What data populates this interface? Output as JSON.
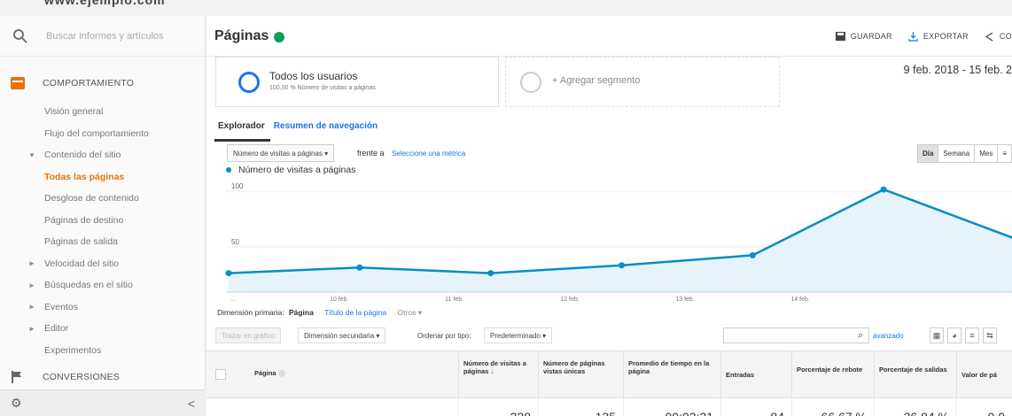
{
  "sidebar": {
    "search_placeholder": "Buscar informes y artículos",
    "section_behavior": "COMPORTAMIENTO",
    "items": [
      {
        "label": "Visión general"
      },
      {
        "label": "Flujo del comportamiento"
      },
      {
        "label": "Contenido del sitio",
        "arrow": "▼"
      },
      {
        "label": "Todas las páginas",
        "active": true
      },
      {
        "label": "Desglose de contenido"
      },
      {
        "label": "Páginas de destino"
      },
      {
        "label": "Páginas de salida"
      },
      {
        "label": "Velocidad del sitio",
        "arrow": "►"
      },
      {
        "label": "Búsquedas en el sitio",
        "arrow": "►"
      },
      {
        "label": "Eventos",
        "arrow": "►"
      },
      {
        "label": "Editor",
        "arrow": "►"
      },
      {
        "label": "Experimentos"
      }
    ],
    "section_conversions": "CONVERSIONES",
    "collapse_glyph": "<"
  },
  "header": {
    "title": "Páginas",
    "actions": {
      "save": "GUARDAR",
      "export": "EXPORTAR",
      "share": "CO"
    }
  },
  "segments": {
    "active_title": "Todos los usuarios",
    "active_subtitle": "100,00 % Número de visitas a páginas",
    "add_label": "+ Agregar segmento"
  },
  "date_range": "9 feb. 2018 - 15 feb. 2",
  "tabs": {
    "explorer": "Explorador",
    "nav_summary": "Resumen de navegación"
  },
  "metric_bar": {
    "metric": "Número de visitas a páginas",
    "versus": "frente a",
    "select_metric": "Seleccione una métrica",
    "day": "Día",
    "week": "Semana",
    "month": "Mes"
  },
  "chart_data": {
    "type": "area",
    "series": [
      {
        "name": "Número de visitas a páginas",
        "values": [
          17,
          22,
          17,
          24,
          33,
          92,
          48
        ]
      }
    ],
    "x": [
      "",
      "10 feb.",
      "11 feb.",
      "12 feb.",
      "13 feb.",
      "14 feb.",
      ""
    ],
    "first_tick": "...",
    "ylim": [
      0,
      100
    ],
    "y_ticks": [
      "100",
      "50"
    ],
    "color": "#058dc7"
  },
  "dimension": {
    "label": "Dimensión primaria:",
    "current": "Página",
    "alt": "Título de la página",
    "others": "Otros ▾"
  },
  "toolbar": {
    "plot_rows": "Trazar en gráfico",
    "secondary": "Dimensión secundaria ▾",
    "sort_label": "Ordenar por tipo:",
    "sort_value": "Predeterminado ▾",
    "advanced": "avanzado"
  },
  "table": {
    "headers": [
      "Página",
      "Número de visitas a páginas",
      "Número de páginas vistas únicas",
      "Promedio de tiempo en la página",
      "Entradas",
      "Porcentaje de rebote",
      "Porcentaje de salidas",
      "Valor de pá"
    ],
    "totals": [
      "228",
      "135",
      "00:02:21",
      "84",
      "66,67 %",
      "36,84 %",
      "0,0"
    ]
  }
}
